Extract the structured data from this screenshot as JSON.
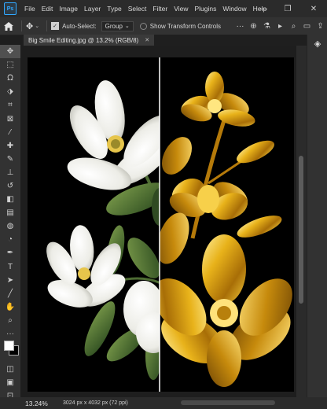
{
  "app": {
    "logo": "Ps"
  },
  "menu": [
    "File",
    "Edit",
    "Image",
    "Layer",
    "Type",
    "Select",
    "Filter",
    "View",
    "Plugins",
    "Window",
    "Help"
  ],
  "window_controls": {
    "minimize": "—",
    "maximize": "❐",
    "close": "✕"
  },
  "options_bar": {
    "auto_select_label": "Auto-Select:",
    "auto_select_checked": true,
    "target_select": "Group",
    "transform_label": "Show Transform Controls"
  },
  "document": {
    "tab_title": "Big Smile Editing.jpg @ 13.2% (RGB/8)",
    "tab_close": "✕",
    "zoom": "13.24%",
    "info": "3024 px x 4032 px (72 ppi)"
  },
  "colors": {
    "accent": "#31a8ff",
    "gold": "#d9a517",
    "gold_dark": "#8a5a08",
    "petal": "#f2f2ee",
    "leaf": "#3f5e2c"
  }
}
